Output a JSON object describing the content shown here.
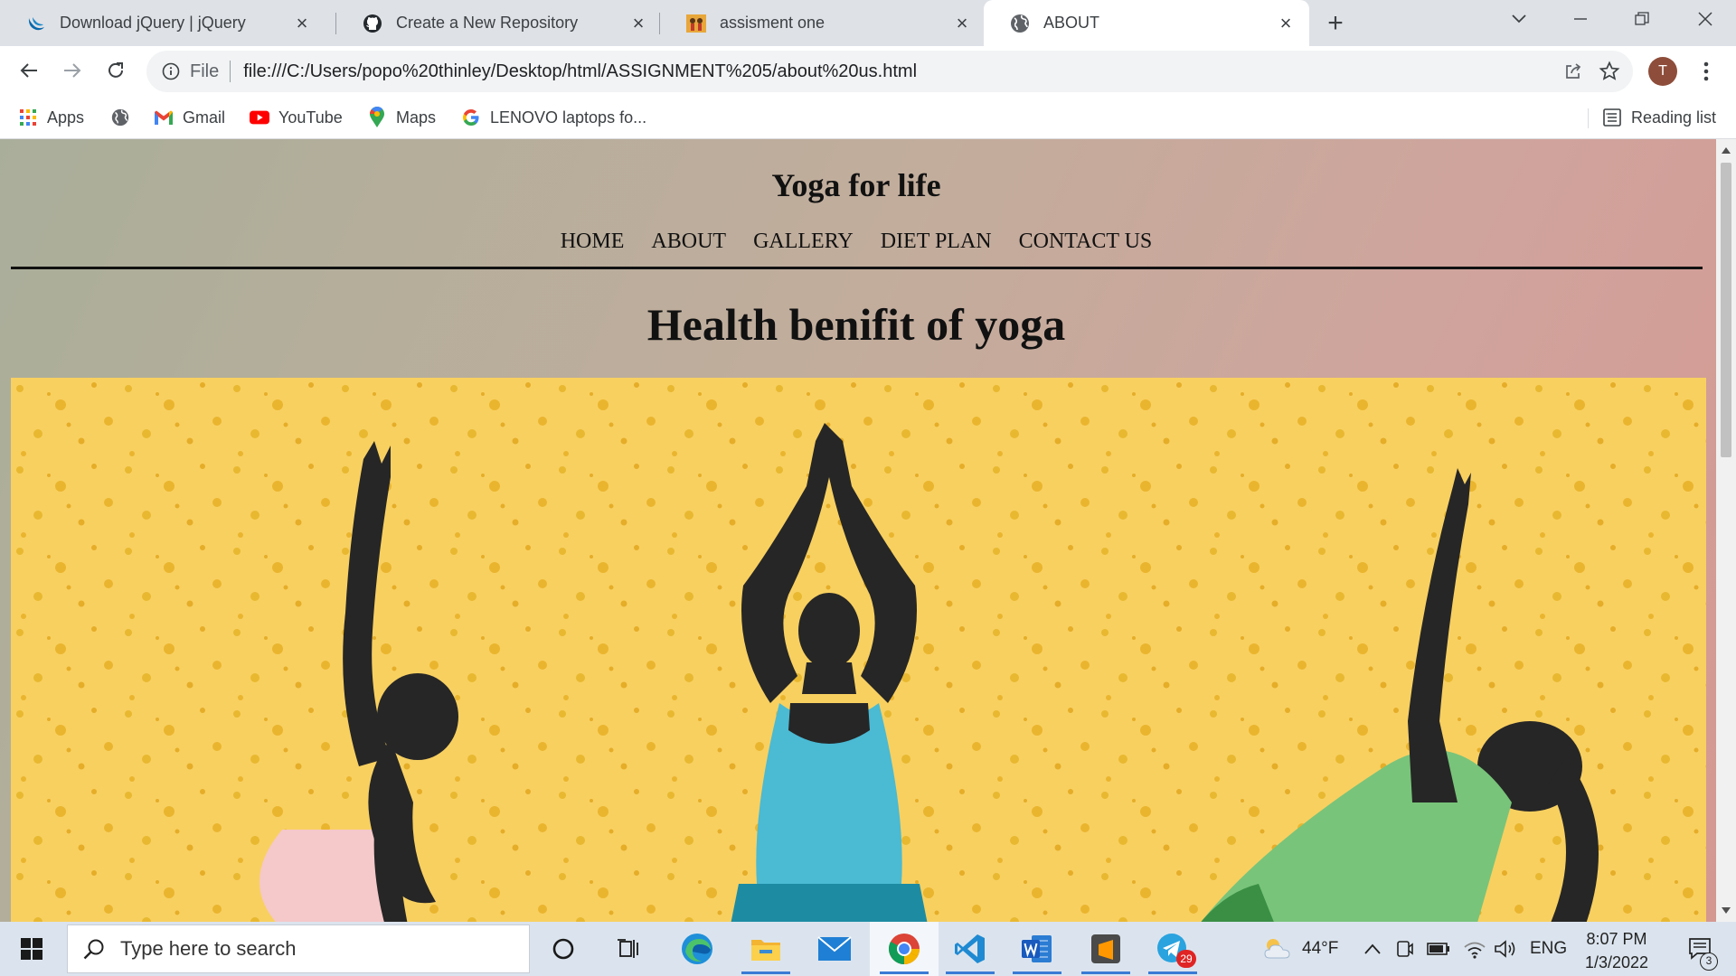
{
  "browser": {
    "tabs": [
      {
        "title": "Download jQuery | jQuery",
        "favicon": "jquery-icon",
        "active": false
      },
      {
        "title": "Create a New Repository",
        "favicon": "github-icon",
        "active": false
      },
      {
        "title": "assisment one",
        "favicon": "yoga-thumbnail-icon",
        "active": false
      },
      {
        "title": "ABOUT",
        "favicon": "globe-icon",
        "active": true
      }
    ],
    "omnibox": {
      "scheme_label": "File",
      "url": "file:///C:/Users/popo%20thinley/Desktop/html/ASSIGNMENT%205/about%20us.html"
    },
    "profile_initial": "T",
    "bookmarks": [
      {
        "label": "Apps",
        "icon": "apps-grid-icon"
      },
      {
        "label": "",
        "icon": "globe-icon"
      },
      {
        "label": "Gmail",
        "icon": "gmail-icon"
      },
      {
        "label": "YouTube",
        "icon": "youtube-icon"
      },
      {
        "label": "Maps",
        "icon": "maps-pin-icon"
      },
      {
        "label": "LENOVO laptops fo...",
        "icon": "google-icon"
      }
    ],
    "reading_list_label": "Reading list"
  },
  "page": {
    "site_title": "Yoga for life",
    "nav": [
      "HOME",
      "ABOUT",
      "GALLERY",
      "DIET PLAN",
      "CONTACT US"
    ],
    "heading": "Health benifit of yoga",
    "hero_image": "yoga-illustration",
    "colors": {
      "gradient_left": "#a9ae9a",
      "gradient_right": "#d49891",
      "hero_bg": "#f8d060"
    }
  },
  "taskbar": {
    "search_placeholder": "Type here to search",
    "apps": [
      "cortana-icon",
      "task-view-icon",
      "edge-icon",
      "file-explorer-icon",
      "mail-icon",
      "chrome-icon",
      "vscode-icon",
      "word-icon",
      "sublime-text-icon",
      "telegram-icon"
    ],
    "telegram_badge": "29",
    "weather": "44°F",
    "language": "ENG",
    "time": "8:07 PM",
    "date": "1/3/2022",
    "notification_count": "3"
  }
}
